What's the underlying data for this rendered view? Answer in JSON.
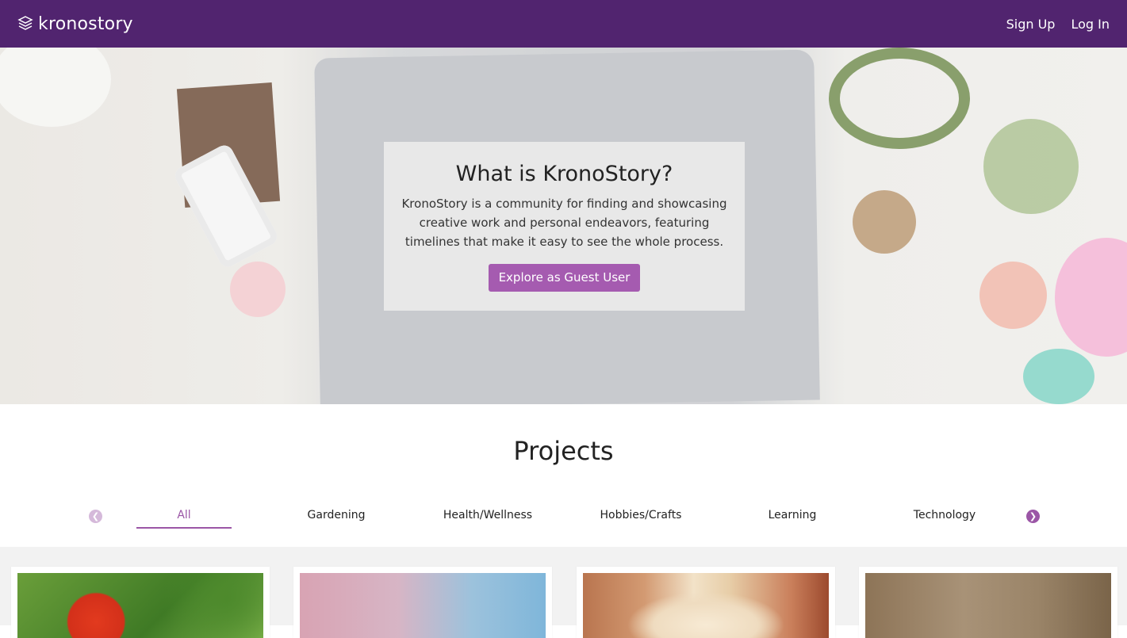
{
  "header": {
    "logo_text": "kronostory",
    "logo_icon": "layers-icon",
    "signup_label": "Sign Up",
    "login_label": "Log In",
    "bg_color": "#51246f"
  },
  "hero": {
    "title": "What is KronoStory?",
    "description": "KronoStory is a community for finding and showcasing creative work and personal endeavors, featuring timelines that make it easy to see the whole process.",
    "button_label": "Explore as Guest User",
    "button_color": "#a55bb0"
  },
  "projects": {
    "title": "Projects",
    "prev_icon": "chevron-left-icon",
    "next_icon": "chevron-right-icon",
    "categories": [
      {
        "label": "All",
        "active": true
      },
      {
        "label": "Gardening",
        "active": false
      },
      {
        "label": "Health/Wellness",
        "active": false
      },
      {
        "label": "Hobbies/Crafts",
        "active": false
      },
      {
        "label": "Learning",
        "active": false
      },
      {
        "label": "Technology",
        "active": false
      }
    ],
    "accent_color": "#9b56a6",
    "cards": [
      {
        "image": "tomato-plant-photo"
      },
      {
        "image": "abstract-light-photo"
      },
      {
        "image": "dog-photo"
      },
      {
        "image": "craft-letters-photo"
      }
    ]
  }
}
